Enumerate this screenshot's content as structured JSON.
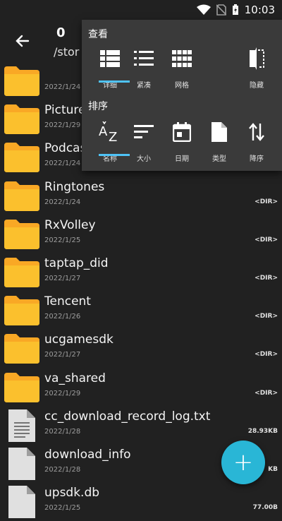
{
  "status": {
    "time": "10:03"
  },
  "header": {
    "count": "0",
    "path": "/stor"
  },
  "popup": {
    "view_title": "查看",
    "view_options": [
      {
        "label": "详细",
        "icon": "list-detail-icon",
        "selected": true
      },
      {
        "label": "紧凑",
        "icon": "list-compact-icon",
        "selected": false
      },
      {
        "label": "网格",
        "icon": "grid-icon",
        "selected": false
      },
      {
        "label": "隐藏",
        "icon": "hide-icon",
        "selected": false
      }
    ],
    "sort_title": "排序",
    "sort_options": [
      {
        "label": "名称",
        "icon": "sort-az-icon",
        "selected": true
      },
      {
        "label": "大小",
        "icon": "sort-size-icon",
        "selected": false
      },
      {
        "label": "日期",
        "icon": "calendar-icon",
        "selected": false
      },
      {
        "label": "类型",
        "icon": "file-type-icon",
        "selected": false
      },
      {
        "label": "降序",
        "icon": "sort-order-icon",
        "selected": false
      }
    ]
  },
  "files": [
    {
      "name": "",
      "date": "2022/1/24",
      "meta": "",
      "kind": "folder"
    },
    {
      "name": "Pictures",
      "date": "2022/1/29",
      "meta": "",
      "kind": "folder"
    },
    {
      "name": "Podcasts",
      "date": "2022/1/24",
      "meta": "",
      "kind": "folder"
    },
    {
      "name": "Ringtones",
      "date": "2022/1/24",
      "meta": "<DIR>",
      "kind": "folder"
    },
    {
      "name": "RxVolley",
      "date": "2022/1/25",
      "meta": "<DIR>",
      "kind": "folder"
    },
    {
      "name": "taptap_did",
      "date": "2022/1/27",
      "meta": "<DIR>",
      "kind": "folder"
    },
    {
      "name": "Tencent",
      "date": "2022/1/26",
      "meta": "<DIR>",
      "kind": "folder"
    },
    {
      "name": "ucgamesdk",
      "date": "2022/1/27",
      "meta": "<DIR>",
      "kind": "folder"
    },
    {
      "name": "va_shared",
      "date": "2022/1/29",
      "meta": "<DIR>",
      "kind": "folder"
    },
    {
      "name": "cc_download_record_log.txt",
      "date": "2022/1/28",
      "meta": "28.93KB",
      "kind": "text"
    },
    {
      "name": "download_info",
      "date": "2022/1/28",
      "meta": "KB",
      "kind": "file"
    },
    {
      "name": "upsdk.db",
      "date": "2022/1/25",
      "meta": "77.00B",
      "kind": "file"
    }
  ],
  "fab": {
    "label": "+"
  },
  "colors": {
    "folder": "#f9a825",
    "accent": "#29b6d6",
    "selected_bar": "#4fc3f7",
    "popup_bg": "#3a3a3a"
  }
}
